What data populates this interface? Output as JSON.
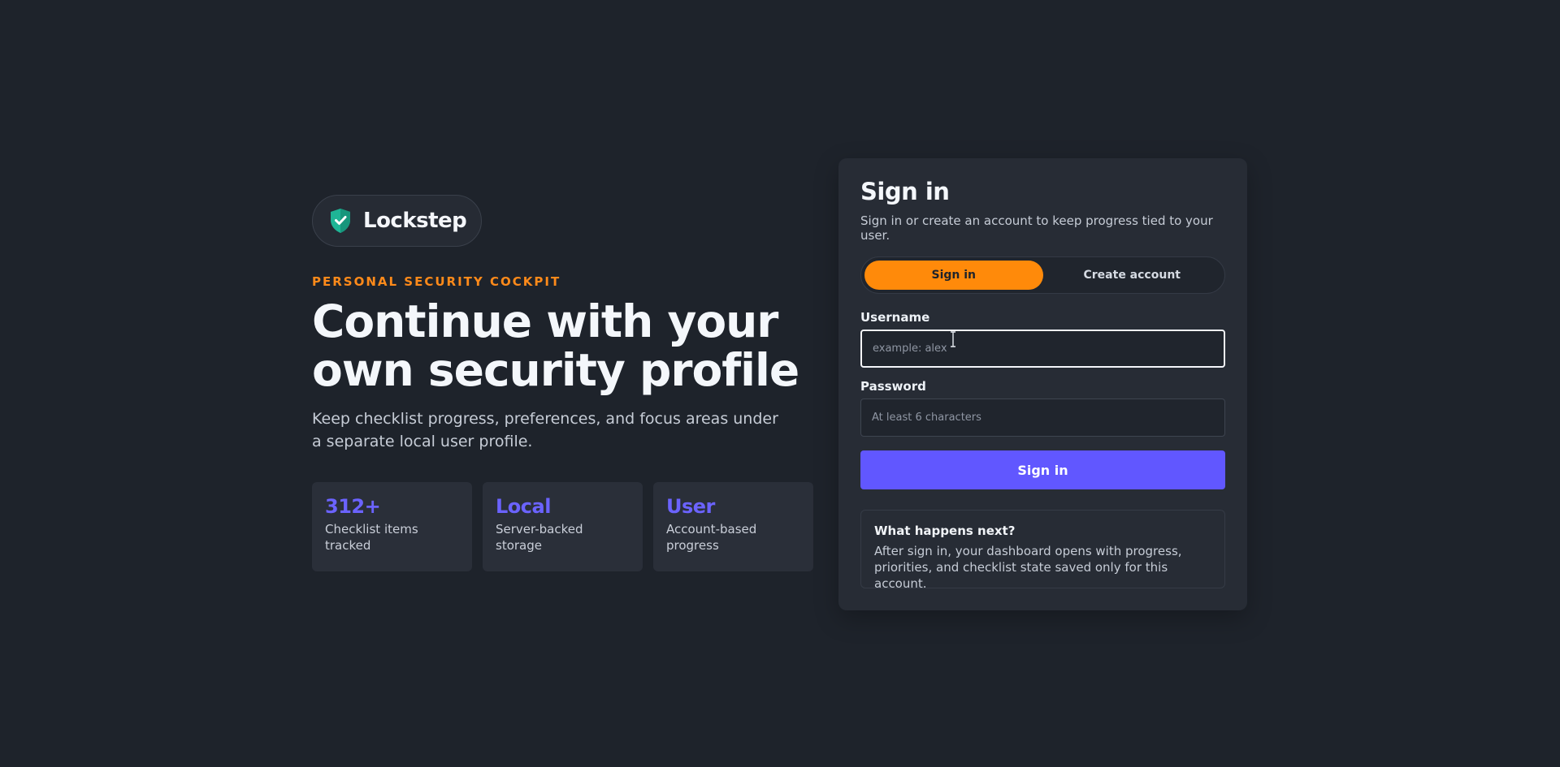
{
  "brand": {
    "name": "Lockstep",
    "icon": "shield-check-icon",
    "icon_color": "#22b89a"
  },
  "hero": {
    "eyebrow": "PERSONAL SECURITY COCKPIT",
    "headline_line1": "Continue with your",
    "headline_line2": "own security profile",
    "lede": "Keep checklist progress, preferences, and focus areas under a separate local user profile."
  },
  "stats": [
    {
      "value": "312+",
      "label": "Checklist items tracked"
    },
    {
      "value": "Local",
      "label": "Server-backed storage"
    },
    {
      "value": "User",
      "label": "Account-based progress"
    }
  ],
  "auth": {
    "title": "Sign in",
    "subtitle": "Sign in or create an account to keep progress tied to your user.",
    "tabs": [
      {
        "label": "Sign in",
        "active": true
      },
      {
        "label": "Create account",
        "active": false
      }
    ],
    "username": {
      "label": "Username",
      "placeholder": "example: alex",
      "value": ""
    },
    "password": {
      "label": "Password",
      "placeholder": "At least 6 characters",
      "value": ""
    },
    "submit_label": "Sign in",
    "info": {
      "title": "What happens next?",
      "body": "After sign in, your dashboard opens with progress, priorities, and checklist state saved only for this account."
    }
  },
  "colors": {
    "background": "#1e232b",
    "accent_orange": "#ff8a0a",
    "accent_purple": "#6157ff",
    "card": "#272c35"
  }
}
